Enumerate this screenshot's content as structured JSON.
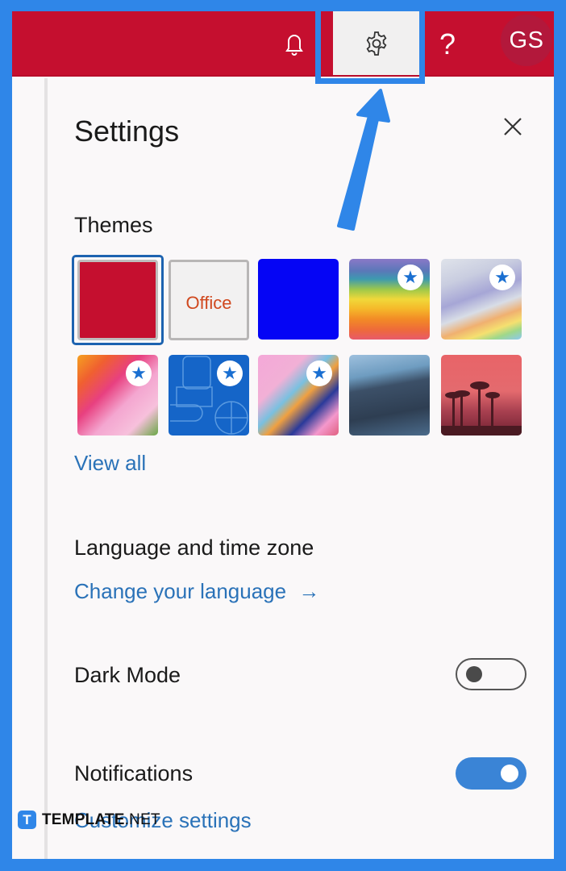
{
  "topbar": {
    "icons": [
      "bell-icon",
      "gear-icon",
      "help-icon"
    ],
    "help_glyph": "?",
    "avatar_initials": "GS",
    "brand_color": "#c50f2f"
  },
  "panel": {
    "title": "Settings",
    "close_icon": "close-icon"
  },
  "themes": {
    "heading": "Themes",
    "view_all": "View all",
    "items": [
      {
        "name": "Red",
        "selected": true,
        "premium": false
      },
      {
        "name": "Office",
        "label": "Office",
        "selected": false,
        "premium": false
      },
      {
        "name": "Blue",
        "selected": false,
        "premium": false
      },
      {
        "name": "Rainbow waves",
        "selected": false,
        "premium": true
      },
      {
        "name": "Silver rainbow",
        "selected": false,
        "premium": true
      },
      {
        "name": "Unicorn",
        "selected": false,
        "premium": true
      },
      {
        "name": "Blue school",
        "selected": false,
        "premium": true
      },
      {
        "name": "Pink toys",
        "selected": false,
        "premium": true
      },
      {
        "name": "Mountain",
        "selected": false,
        "premium": false
      },
      {
        "name": "Palm sunset",
        "selected": false,
        "premium": false
      }
    ]
  },
  "language": {
    "heading": "Language and time zone",
    "link": "Change your language",
    "link_arrow": "→"
  },
  "dark_mode": {
    "label": "Dark Mode",
    "enabled": false
  },
  "notifications": {
    "label": "Notifications",
    "enabled": true,
    "link": "Customize settings"
  },
  "watermark": {
    "logo_letter": "T",
    "brand": "TEMPLATE",
    "suffix": ".NET"
  },
  "accent_color": "#2f86e8",
  "link_color": "#2a72b8"
}
